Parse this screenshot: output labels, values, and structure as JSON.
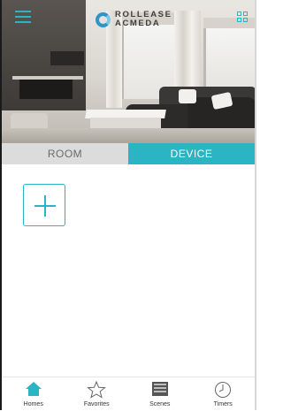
{
  "header": {
    "menu_icon": "hamburger-menu-icon",
    "brand_line1": "ROLLEASE",
    "brand_line2": "ACMEDA",
    "grid_icon": "grid-view-icon",
    "accent_color": "#2bb5c4"
  },
  "tabs": [
    {
      "label": "ROOM",
      "active": false
    },
    {
      "label": "DEVICE",
      "active": true
    }
  ],
  "content": {
    "add_icon": "plus-icon"
  },
  "bottom_nav": [
    {
      "label": "Homes",
      "icon": "home-icon",
      "active": true
    },
    {
      "label": "Favorites",
      "icon": "star-icon",
      "active": false
    },
    {
      "label": "Scenes",
      "icon": "scenes-icon",
      "active": false
    },
    {
      "label": "Timers",
      "icon": "clock-icon",
      "active": false
    }
  ]
}
